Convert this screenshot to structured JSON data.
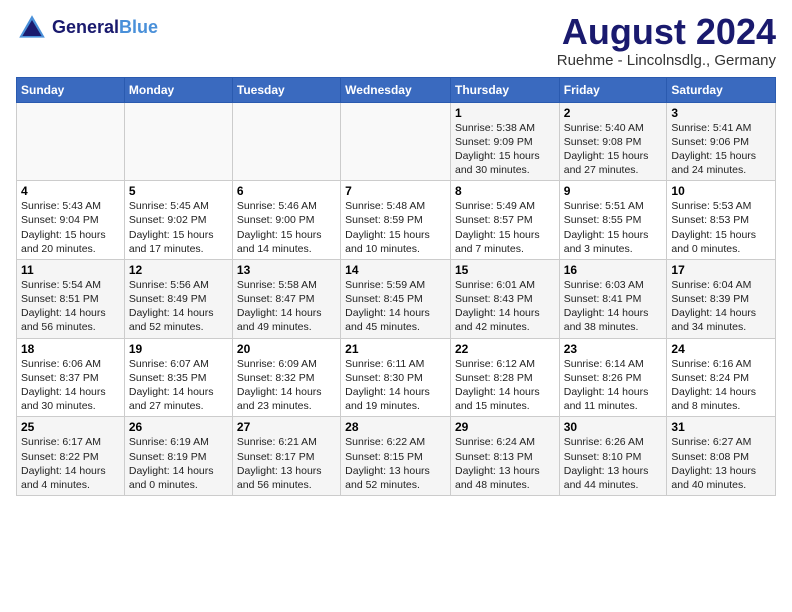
{
  "header": {
    "logo_line1": "General",
    "logo_line2": "Blue",
    "main_title": "August 2024",
    "subtitle": "Ruehme - Lincolnsdlg., Germany"
  },
  "days_of_week": [
    "Sunday",
    "Monday",
    "Tuesday",
    "Wednesday",
    "Thursday",
    "Friday",
    "Saturday"
  ],
  "weeks": [
    [
      {
        "day": "",
        "text": ""
      },
      {
        "day": "",
        "text": ""
      },
      {
        "day": "",
        "text": ""
      },
      {
        "day": "",
        "text": ""
      },
      {
        "day": "1",
        "text": "Sunrise: 5:38 AM\nSunset: 9:09 PM\nDaylight: 15 hours and 30 minutes."
      },
      {
        "day": "2",
        "text": "Sunrise: 5:40 AM\nSunset: 9:08 PM\nDaylight: 15 hours and 27 minutes."
      },
      {
        "day": "3",
        "text": "Sunrise: 5:41 AM\nSunset: 9:06 PM\nDaylight: 15 hours and 24 minutes."
      }
    ],
    [
      {
        "day": "4",
        "text": "Sunrise: 5:43 AM\nSunset: 9:04 PM\nDaylight: 15 hours and 20 minutes."
      },
      {
        "day": "5",
        "text": "Sunrise: 5:45 AM\nSunset: 9:02 PM\nDaylight: 15 hours and 17 minutes."
      },
      {
        "day": "6",
        "text": "Sunrise: 5:46 AM\nSunset: 9:00 PM\nDaylight: 15 hours and 14 minutes."
      },
      {
        "day": "7",
        "text": "Sunrise: 5:48 AM\nSunset: 8:59 PM\nDaylight: 15 hours and 10 minutes."
      },
      {
        "day": "8",
        "text": "Sunrise: 5:49 AM\nSunset: 8:57 PM\nDaylight: 15 hours and 7 minutes."
      },
      {
        "day": "9",
        "text": "Sunrise: 5:51 AM\nSunset: 8:55 PM\nDaylight: 15 hours and 3 minutes."
      },
      {
        "day": "10",
        "text": "Sunrise: 5:53 AM\nSunset: 8:53 PM\nDaylight: 15 hours and 0 minutes."
      }
    ],
    [
      {
        "day": "11",
        "text": "Sunrise: 5:54 AM\nSunset: 8:51 PM\nDaylight: 14 hours and 56 minutes."
      },
      {
        "day": "12",
        "text": "Sunrise: 5:56 AM\nSunset: 8:49 PM\nDaylight: 14 hours and 52 minutes."
      },
      {
        "day": "13",
        "text": "Sunrise: 5:58 AM\nSunset: 8:47 PM\nDaylight: 14 hours and 49 minutes."
      },
      {
        "day": "14",
        "text": "Sunrise: 5:59 AM\nSunset: 8:45 PM\nDaylight: 14 hours and 45 minutes."
      },
      {
        "day": "15",
        "text": "Sunrise: 6:01 AM\nSunset: 8:43 PM\nDaylight: 14 hours and 42 minutes."
      },
      {
        "day": "16",
        "text": "Sunrise: 6:03 AM\nSunset: 8:41 PM\nDaylight: 14 hours and 38 minutes."
      },
      {
        "day": "17",
        "text": "Sunrise: 6:04 AM\nSunset: 8:39 PM\nDaylight: 14 hours and 34 minutes."
      }
    ],
    [
      {
        "day": "18",
        "text": "Sunrise: 6:06 AM\nSunset: 8:37 PM\nDaylight: 14 hours and 30 minutes."
      },
      {
        "day": "19",
        "text": "Sunrise: 6:07 AM\nSunset: 8:35 PM\nDaylight: 14 hours and 27 minutes."
      },
      {
        "day": "20",
        "text": "Sunrise: 6:09 AM\nSunset: 8:32 PM\nDaylight: 14 hours and 23 minutes."
      },
      {
        "day": "21",
        "text": "Sunrise: 6:11 AM\nSunset: 8:30 PM\nDaylight: 14 hours and 19 minutes."
      },
      {
        "day": "22",
        "text": "Sunrise: 6:12 AM\nSunset: 8:28 PM\nDaylight: 14 hours and 15 minutes."
      },
      {
        "day": "23",
        "text": "Sunrise: 6:14 AM\nSunset: 8:26 PM\nDaylight: 14 hours and 11 minutes."
      },
      {
        "day": "24",
        "text": "Sunrise: 6:16 AM\nSunset: 8:24 PM\nDaylight: 14 hours and 8 minutes."
      }
    ],
    [
      {
        "day": "25",
        "text": "Sunrise: 6:17 AM\nSunset: 8:22 PM\nDaylight: 14 hours and 4 minutes."
      },
      {
        "day": "26",
        "text": "Sunrise: 6:19 AM\nSunset: 8:19 PM\nDaylight: 14 hours and 0 minutes."
      },
      {
        "day": "27",
        "text": "Sunrise: 6:21 AM\nSunset: 8:17 PM\nDaylight: 13 hours and 56 minutes."
      },
      {
        "day": "28",
        "text": "Sunrise: 6:22 AM\nSunset: 8:15 PM\nDaylight: 13 hours and 52 minutes."
      },
      {
        "day": "29",
        "text": "Sunrise: 6:24 AM\nSunset: 8:13 PM\nDaylight: 13 hours and 48 minutes."
      },
      {
        "day": "30",
        "text": "Sunrise: 6:26 AM\nSunset: 8:10 PM\nDaylight: 13 hours and 44 minutes."
      },
      {
        "day": "31",
        "text": "Sunrise: 6:27 AM\nSunset: 8:08 PM\nDaylight: 13 hours and 40 minutes."
      }
    ]
  ]
}
